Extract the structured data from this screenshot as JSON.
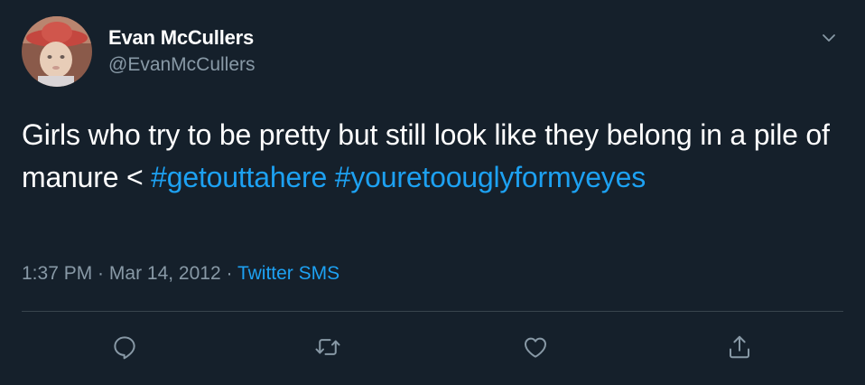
{
  "tweet": {
    "user": {
      "name": "Evan McCullers",
      "handle": "@EvanMcCullers",
      "avatar_icon": "profile-photo"
    },
    "text": {
      "part1": "Girls who try to be pretty but still look like they belong in a pile of manure < ",
      "hashtag1": "#getouttahere",
      "hashtag2": "#youretoouglyformyeyes"
    },
    "time": "1:37 PM",
    "sep1": " · ",
    "date": "Mar 14, 2012",
    "sep2": " · ",
    "source": "Twitter SMS",
    "actions": [
      "reply-icon",
      "retweet-icon",
      "like-icon",
      "share-icon"
    ],
    "menu_icon": "chevron-down-icon"
  },
  "colors": {
    "background": "#15202b",
    "text": "#ffffff",
    "muted": "#8899a6",
    "accent": "#1da1f2",
    "divider": "#38444d"
  }
}
